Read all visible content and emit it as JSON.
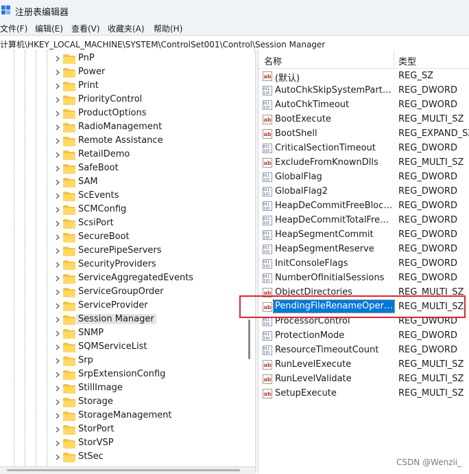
{
  "window": {
    "title": "注册表编辑器",
    "icon": "registry-editor-icon"
  },
  "menu": [
    "文件(F)",
    "编辑(E)",
    "查看(V)",
    "收藏夹(A)",
    "帮助(H)"
  ],
  "address": {
    "path": "计算机\\HKEY_LOCAL_MACHINE\\SYSTEM\\ControlSet001\\Control\\Session Manager"
  },
  "tree": {
    "items": [
      {
        "label": "PnP"
      },
      {
        "label": "Power"
      },
      {
        "label": "Print"
      },
      {
        "label": "PriorityControl"
      },
      {
        "label": "ProductOptions"
      },
      {
        "label": "RadioManagement"
      },
      {
        "label": "Remote Assistance"
      },
      {
        "label": "RetailDemo"
      },
      {
        "label": "SafeBoot"
      },
      {
        "label": "SAM"
      },
      {
        "label": "ScEvents"
      },
      {
        "label": "SCMConfig"
      },
      {
        "label": "ScsiPort"
      },
      {
        "label": "SecureBoot"
      },
      {
        "label": "SecurePipeServers"
      },
      {
        "label": "SecurityProviders"
      },
      {
        "label": "ServiceAggregatedEvents"
      },
      {
        "label": "ServiceGroupOrder"
      },
      {
        "label": "ServiceProvider"
      },
      {
        "label": "Session Manager",
        "selected": true
      },
      {
        "label": "SNMP"
      },
      {
        "label": "SQMServiceList"
      },
      {
        "label": "Srp"
      },
      {
        "label": "SrpExtensionConfig"
      },
      {
        "label": "StillImage"
      },
      {
        "label": "Storage"
      },
      {
        "label": "StorageManagement"
      },
      {
        "label": "StorPort"
      },
      {
        "label": "StorVSP"
      },
      {
        "label": "StSec"
      }
    ]
  },
  "values": {
    "columns": {
      "name": "名称",
      "type": "类型"
    },
    "rows": [
      {
        "name": "(默认)",
        "type": "REG_SZ",
        "icon": "string-value-icon"
      },
      {
        "name": "AutoChkSkipSystemPartition",
        "type": "REG_DWORD",
        "icon": "binary-value-icon"
      },
      {
        "name": "AutoChkTimeout",
        "type": "REG_DWORD",
        "icon": "binary-value-icon"
      },
      {
        "name": "BootExecute",
        "type": "REG_MULTI_SZ",
        "icon": "string-value-icon"
      },
      {
        "name": "BootShell",
        "type": "REG_EXPAND_SZ",
        "icon": "string-value-icon"
      },
      {
        "name": "CriticalSectionTimeout",
        "type": "REG_DWORD",
        "icon": "binary-value-icon"
      },
      {
        "name": "ExcludeFromKnownDlls",
        "type": "REG_MULTI_SZ",
        "icon": "string-value-icon"
      },
      {
        "name": "GlobalFlag",
        "type": "REG_DWORD",
        "icon": "binary-value-icon"
      },
      {
        "name": "GlobalFlag2",
        "type": "REG_DWORD",
        "icon": "binary-value-icon"
      },
      {
        "name": "HeapDeCommitFreeBlockTh...",
        "type": "REG_DWORD",
        "icon": "binary-value-icon"
      },
      {
        "name": "HeapDeCommitTotalFreeTh...",
        "type": "REG_DWORD",
        "icon": "binary-value-icon"
      },
      {
        "name": "HeapSegmentCommit",
        "type": "REG_DWORD",
        "icon": "binary-value-icon"
      },
      {
        "name": "HeapSegmentReserve",
        "type": "REG_DWORD",
        "icon": "binary-value-icon"
      },
      {
        "name": "InitConsoleFlags",
        "type": "REG_DWORD",
        "icon": "binary-value-icon"
      },
      {
        "name": "NumberOfInitialSessions",
        "type": "REG_DWORD",
        "icon": "binary-value-icon"
      },
      {
        "name": "ObjectDirectories",
        "type": "REG_MULTI_SZ",
        "icon": "string-value-icon"
      },
      {
        "name": "PendingFileRenameOperati...",
        "type": "REG_MULTI_SZ",
        "icon": "string-value-icon",
        "selected": true
      },
      {
        "name": "ProcessorControl",
        "type": "REG_DWORD",
        "icon": "binary-value-icon"
      },
      {
        "name": "ProtectionMode",
        "type": "REG_DWORD",
        "icon": "binary-value-icon"
      },
      {
        "name": "ResourceTimeoutCount",
        "type": "REG_DWORD",
        "icon": "binary-value-icon"
      },
      {
        "name": "RunLevelExecute",
        "type": "REG_MULTI_SZ",
        "icon": "string-value-icon"
      },
      {
        "name": "RunLevelValidate",
        "type": "REG_MULTI_SZ",
        "icon": "string-value-icon"
      },
      {
        "name": "SetupExecute",
        "type": "REG_MULTI_SZ",
        "icon": "string-value-icon"
      }
    ]
  },
  "annotation": {
    "color": "#e0232b"
  },
  "watermark": "CSDN @Wenzii_",
  "colors": {
    "selection": "#0078d7",
    "tree_selection": "#e5e5e5",
    "folder": "#f5c242"
  }
}
